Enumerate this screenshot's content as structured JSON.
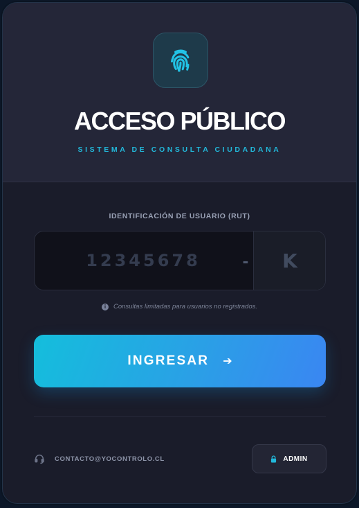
{
  "header": {
    "title": "ACCESO PÚBLICO",
    "subtitle": "SISTEMA DE CONSULTA CIUDADANA",
    "logo_icon": "fingerprint-icon"
  },
  "form": {
    "rut_label": "IDENTIFICACIÓN DE USUARIO (RUT)",
    "rut_placeholder": "12345678",
    "rut_separator": "-",
    "dv_placeholder": "K",
    "note": "Consultas limitadas para usuarios no registrados.",
    "note_icon": "info-icon",
    "submit_label": "INGRESAR",
    "submit_icon": "arrow-right-icon"
  },
  "footer": {
    "contact_email": "CONTACTO@YOCONTROLO.CL",
    "contact_icon": "headset-icon",
    "admin_label": "ADMIN",
    "admin_icon": "lock-icon"
  },
  "colors": {
    "accent": "#22b8da",
    "button_gradient_start": "#14bedc",
    "button_gradient_end": "#3a86f2",
    "background": "#1a1c2a"
  }
}
